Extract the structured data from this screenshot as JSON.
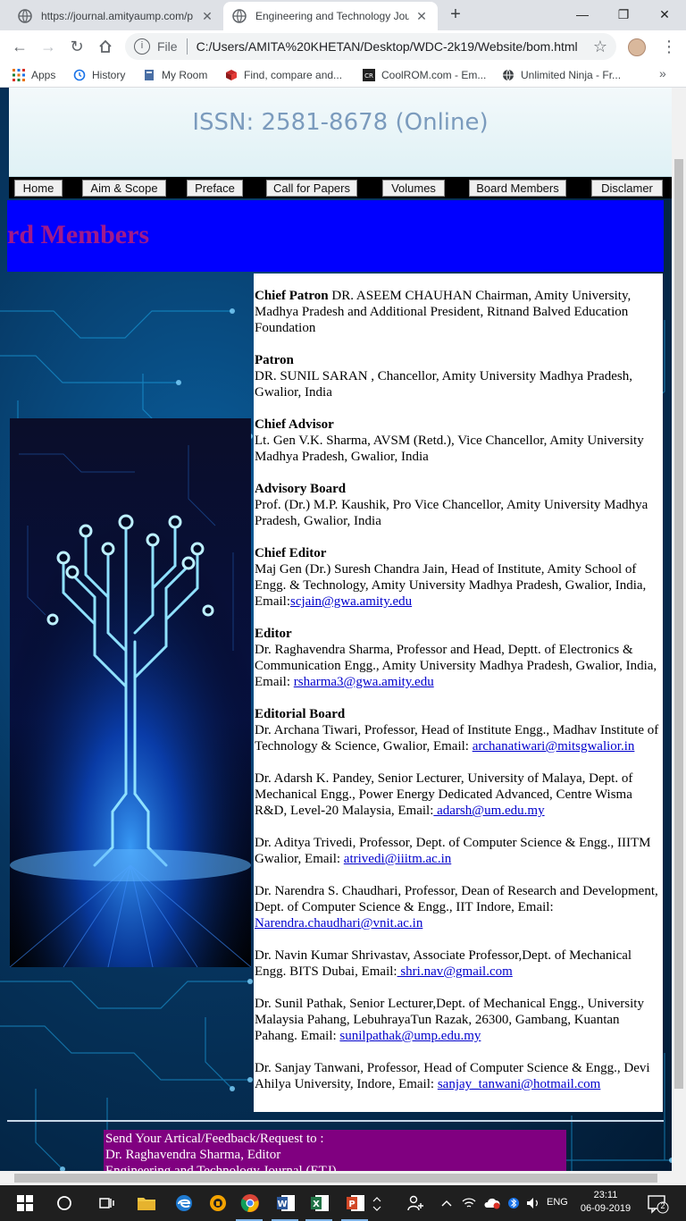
{
  "browser": {
    "tabs": [
      {
        "title": "https://journal.amityaump.com/p",
        "active": false
      },
      {
        "title": "Engineering and Technology Jour",
        "active": true
      }
    ],
    "address": {
      "scheme_label": "File",
      "url": "C:/Users/AMITA%20KHETAN/Desktop/WDC-2k19/Website/bom.html"
    },
    "bookmarks": [
      {
        "label": "Apps",
        "icon": "apps-grid-icon"
      },
      {
        "label": "History",
        "icon": "history-icon"
      },
      {
        "label": "My Room",
        "icon": "bookmark-icon"
      },
      {
        "label": "Find, compare and...",
        "icon": "book-icon"
      },
      {
        "label": "CoolROM.com - Em...",
        "icon": "coolrom-icon"
      },
      {
        "label": "Unlimited Ninja - Fr...",
        "icon": "globe-icon"
      }
    ],
    "overflow_label": "»"
  },
  "page": {
    "issn": "ISSN: 2581-8678 (Online)",
    "nav": [
      "Home",
      "Aim & Scope",
      "Preface",
      "Call for Papers",
      "Volumes",
      "Board Members",
      "Disclamer"
    ],
    "heading": "rd Members",
    "sections": [
      {
        "role": "Chief Patron",
        "inline": true,
        "text": "DR. ASEEM CHAUHAN Chairman, Amity University, Madhya Pradesh and Additional President, Ritnand Balved Education Foundation",
        "email": ""
      },
      {
        "role": "Patron",
        "inline": false,
        "text": "DR. SUNIL SARAN , Chancellor, Amity University Madhya Pradesh, Gwalior, India",
        "email": ""
      },
      {
        "role": "Chief Advisor",
        "inline": false,
        "text": "Lt. Gen V.K. Sharma, AVSM (Retd.), Vice Chancellor, Amity University Madhya Pradesh, Gwalior, India",
        "email": ""
      },
      {
        "role": "Advisory Board",
        "inline": false,
        "text": "Prof. (Dr.) M.P. Kaushik, Pro Vice Chancellor, Amity University Madhya Pradesh, Gwalior, India",
        "email": ""
      },
      {
        "role": "Chief Editor",
        "inline": false,
        "text": "Maj Gen (Dr.) Suresh Chandra Jain, Head of Institute, Amity School of Engg. & Technology, Amity University Madhya Pradesh, Gwalior, India, Email:",
        "email": "scjain@gwa.amity.edu"
      },
      {
        "role": "Editor",
        "inline": false,
        "text": "Dr. Raghavendra Sharma, Professor and Head, Deptt. of Electronics & Communication Engg., Amity University Madhya Pradesh, Gwalior, India, Email: ",
        "email": "rsharma3@gwa.amity.edu"
      }
    ],
    "editorial_board": {
      "role": "Editorial Board",
      "members": [
        {
          "text": "Dr. Archana Tiwari, Professor, Head of Institute Engg., Madhav Institute of Technology & Science, Gwalior, Email: ",
          "email": "archanatiwari@mitsgwalior.in"
        },
        {
          "text": "Dr. Adarsh K. Pandey, Senior Lecturer, University of Malaya, Dept. of Mechanical Engg., Power Energy Dedicated Advanced, Centre Wisma R&D, Level-20 Malaysia, Email:",
          "email": " adarsh@um.edu.my"
        },
        {
          "text": "Dr. Aditya Trivedi, Professor, Dept. of Computer Science & Engg., IIITM Gwalior, Email: ",
          "email": "atrivedi@iiitm.ac.in"
        },
        {
          "text": "Dr. Narendra S. Chaudhari, Professor, Dean of Research and Development, Dept. of Computer Science & Engg., IIT Indore, Email: ",
          "email": "Narendra.chaudhari@vnit.ac.in"
        },
        {
          "text": "Dr. Navin Kumar Shrivastav, Associate Professor,Dept. of Mechanical Engg. BITS Dubai, Email:",
          "email": " shri.nav@gmail.com"
        },
        {
          "text": "Dr. Sunil Pathak, Senior Lecturer,Dept. of Mechanical Engg., University Malaysia Pahang, LebuhrayaTun Razak, 26300, Gambang, Kuantan Pahang. Email: ",
          "email": "sunilpathak@ump.edu.my"
        },
        {
          "text": "Dr. Sanjay Tanwani, Professor, Head of Computer Science & Engg., Devi Ahilya University, Indore, Email: ",
          "email": "sanjay_tanwani@hotmail.com"
        }
      ]
    },
    "footer": {
      "line1": "Send Your Artical/Feedback/Request to :",
      "line2": "Dr. Raghavendra Sharma, Editor",
      "line3": "Engineering and Technology Journal (ETJ)"
    }
  },
  "taskbar": {
    "language": "ENG",
    "time": "23:11",
    "date": "06-09-2019",
    "notification_count": "2"
  },
  "colors": {
    "title_band": "#0000ff",
    "heading": "#a01a8a",
    "footer_box": "#800080",
    "link": "#0000cc"
  }
}
